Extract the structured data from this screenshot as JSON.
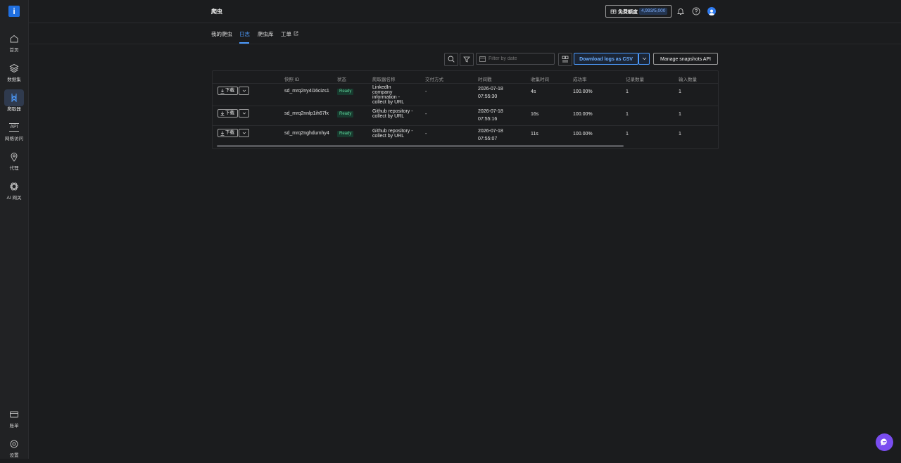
{
  "sidebar": {
    "logo_text": "i",
    "items": [
      {
        "label": "首页",
        "icon": "home-icon"
      },
      {
        "label": "数据集",
        "icon": "layers-icon"
      },
      {
        "label": "爬取器",
        "icon": "scraper-icon",
        "active": true
      },
      {
        "label": "网络访问",
        "icon": "api-icon"
      },
      {
        "label": "代理",
        "icon": "location-pin-icon"
      },
      {
        "label": "AI 网关",
        "icon": "ai-gateway-icon"
      }
    ],
    "bottom_items": [
      {
        "label": "账单",
        "icon": "credit-card-icon"
      },
      {
        "label": "设置",
        "icon": "settings-icon"
      }
    ]
  },
  "header": {
    "title": "爬虫",
    "quota_label": "免费额度",
    "quota_value": "4,993/5,000",
    "api_icon_text": "API"
  },
  "tabs": [
    {
      "label": "我的爬虫"
    },
    {
      "label": "日志",
      "active": true
    },
    {
      "label": "爬虫库"
    },
    {
      "label": "工单",
      "external": true
    }
  ],
  "toolbar": {
    "date_placeholder": "Filter by date",
    "download_csv_label": "Download logs as CSV",
    "manage_api_label": "Manage snapshots API"
  },
  "table": {
    "columns": [
      "快照 ID",
      "状态",
      "爬取器名称",
      "交付方式",
      "时间戳",
      "收集时间",
      "成功率",
      "记录数量",
      "输入数量"
    ],
    "download_label": "下载",
    "rows": [
      {
        "id": "sd_mrq2ny4i16cizs1",
        "status": "Ready",
        "name": "LinkedIn company information - collect by URL",
        "delivery": "-",
        "ts_date": "2026-07-18",
        "ts_time": "07:55:30",
        "collect": "4s",
        "success": "100.00%",
        "records": "1",
        "inputs": "1"
      },
      {
        "id": "sd_mrq2nnlp1ih67fx",
        "status": "Ready",
        "name": "Github repository - collect by URL",
        "delivery": "-",
        "ts_date": "2026-07-18",
        "ts_time": "07:55:16",
        "collect": "16s",
        "success": "100.00%",
        "records": "1",
        "inputs": "1"
      },
      {
        "id": "sd_mrq2nghdumhy4",
        "status": "Ready",
        "name": "Github repository - collect by URL",
        "delivery": "-",
        "ts_date": "2026-07-18",
        "ts_time": "07:55:07",
        "collect": "11s",
        "success": "100.00%",
        "records": "1",
        "inputs": "1"
      }
    ]
  },
  "colors": {
    "background": "#1b1c1e",
    "sidebar": "#212224",
    "accent": "#4d9cff",
    "ready_badge_bg": "#173a2e",
    "ready_badge_text": "#5fd39a",
    "chat_button": "#7a4df0"
  }
}
